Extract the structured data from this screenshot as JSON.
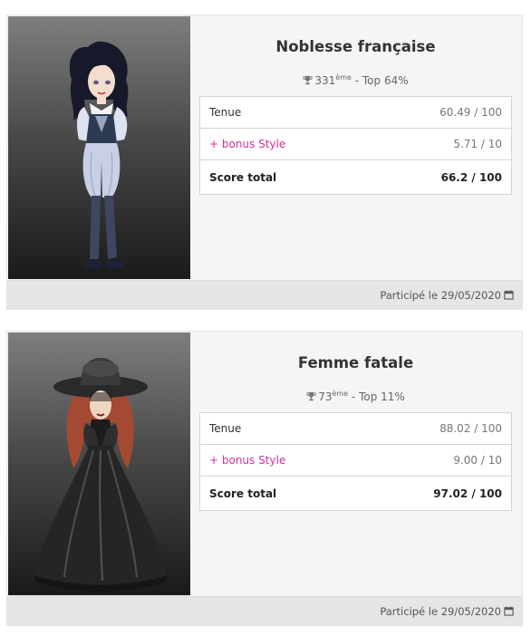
{
  "entries": [
    {
      "title": "Noblesse française",
      "rank_number": "331",
      "rank_suffix": "ème",
      "rank_top": " - Top 64%",
      "rows": [
        {
          "label": "Tenue",
          "value": "60.49 / 100"
        },
        {
          "label": "+ bonus Style",
          "value": "5.71 / 10"
        },
        {
          "label": "Score total",
          "value": "66.2 / 100"
        }
      ],
      "footer": "Participé le 29/05/2020",
      "avatar": "noble-avatar"
    },
    {
      "title": "Femme fatale",
      "rank_number": "73",
      "rank_suffix": "ème",
      "rank_top": " - Top 11%",
      "rows": [
        {
          "label": "Tenue",
          "value": "88.02 / 100"
        },
        {
          "label": "+ bonus Style",
          "value": "9.00 / 10"
        },
        {
          "label": "Score total",
          "value": "97.02 / 100"
        }
      ],
      "footer": "Participé le 29/05/2020",
      "avatar": "fatale-avatar"
    }
  ],
  "colors": {
    "bonus": "#d4309a",
    "card_bg": "#f5f5f5",
    "footer_bg": "#e6e6e6"
  },
  "icons": {
    "rank": "trophy-icon",
    "date": "calendar-icon"
  }
}
